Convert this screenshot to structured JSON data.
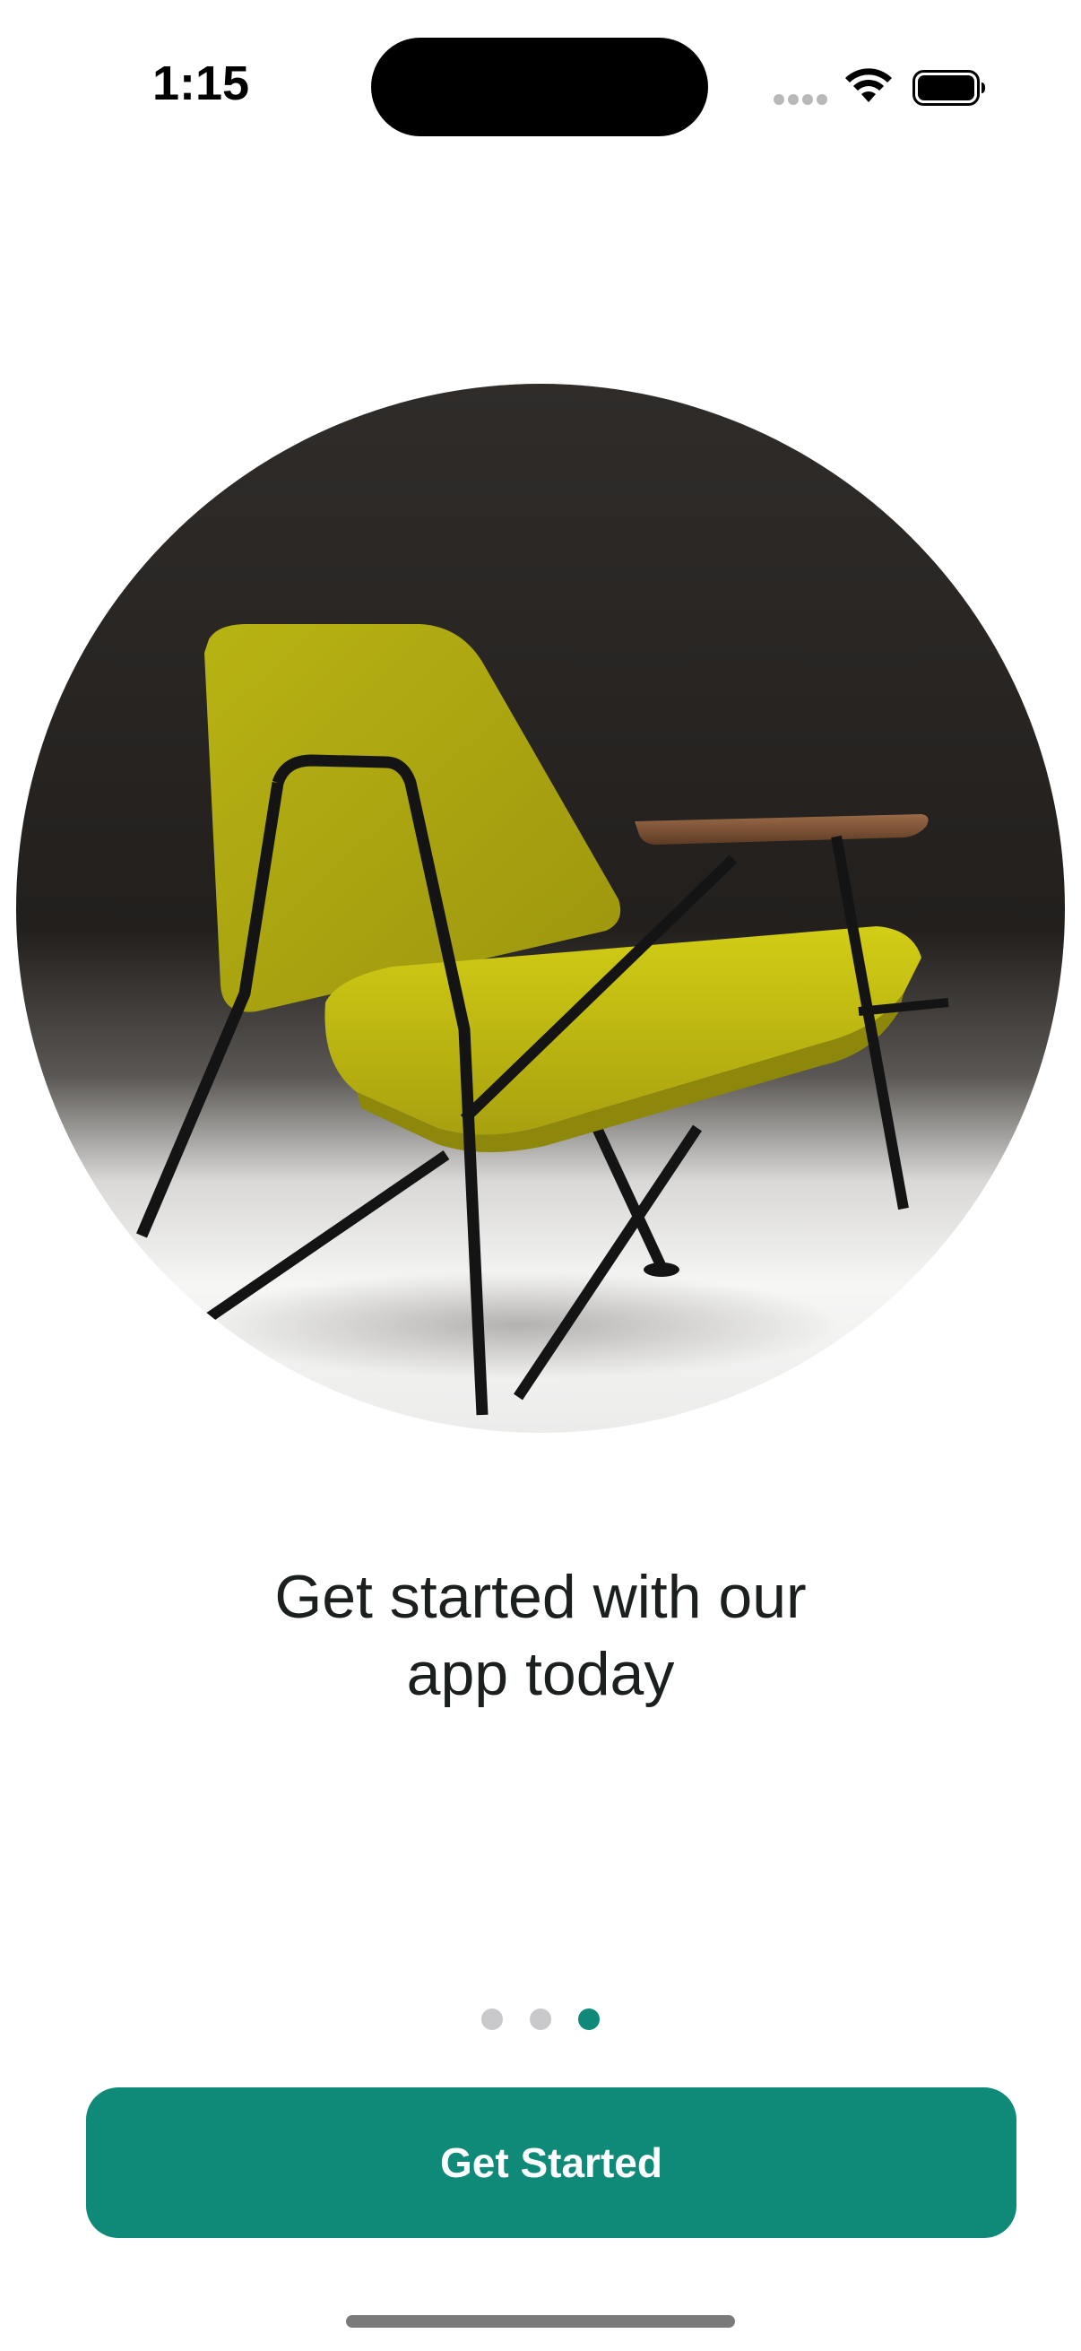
{
  "status_bar": {
    "time": "1:15"
  },
  "onboarding": {
    "hero_image": "yellow-lounge-chair-photo",
    "headline_line1": "Get started with our",
    "headline_line2": "app today",
    "pager": {
      "page_count": 3,
      "current_page": 3
    },
    "cta_label": "Get Started"
  },
  "colors": {
    "accent": "#0f8a78",
    "inactive_dot": "#c9c9cc",
    "text": "#1b1f1e"
  }
}
